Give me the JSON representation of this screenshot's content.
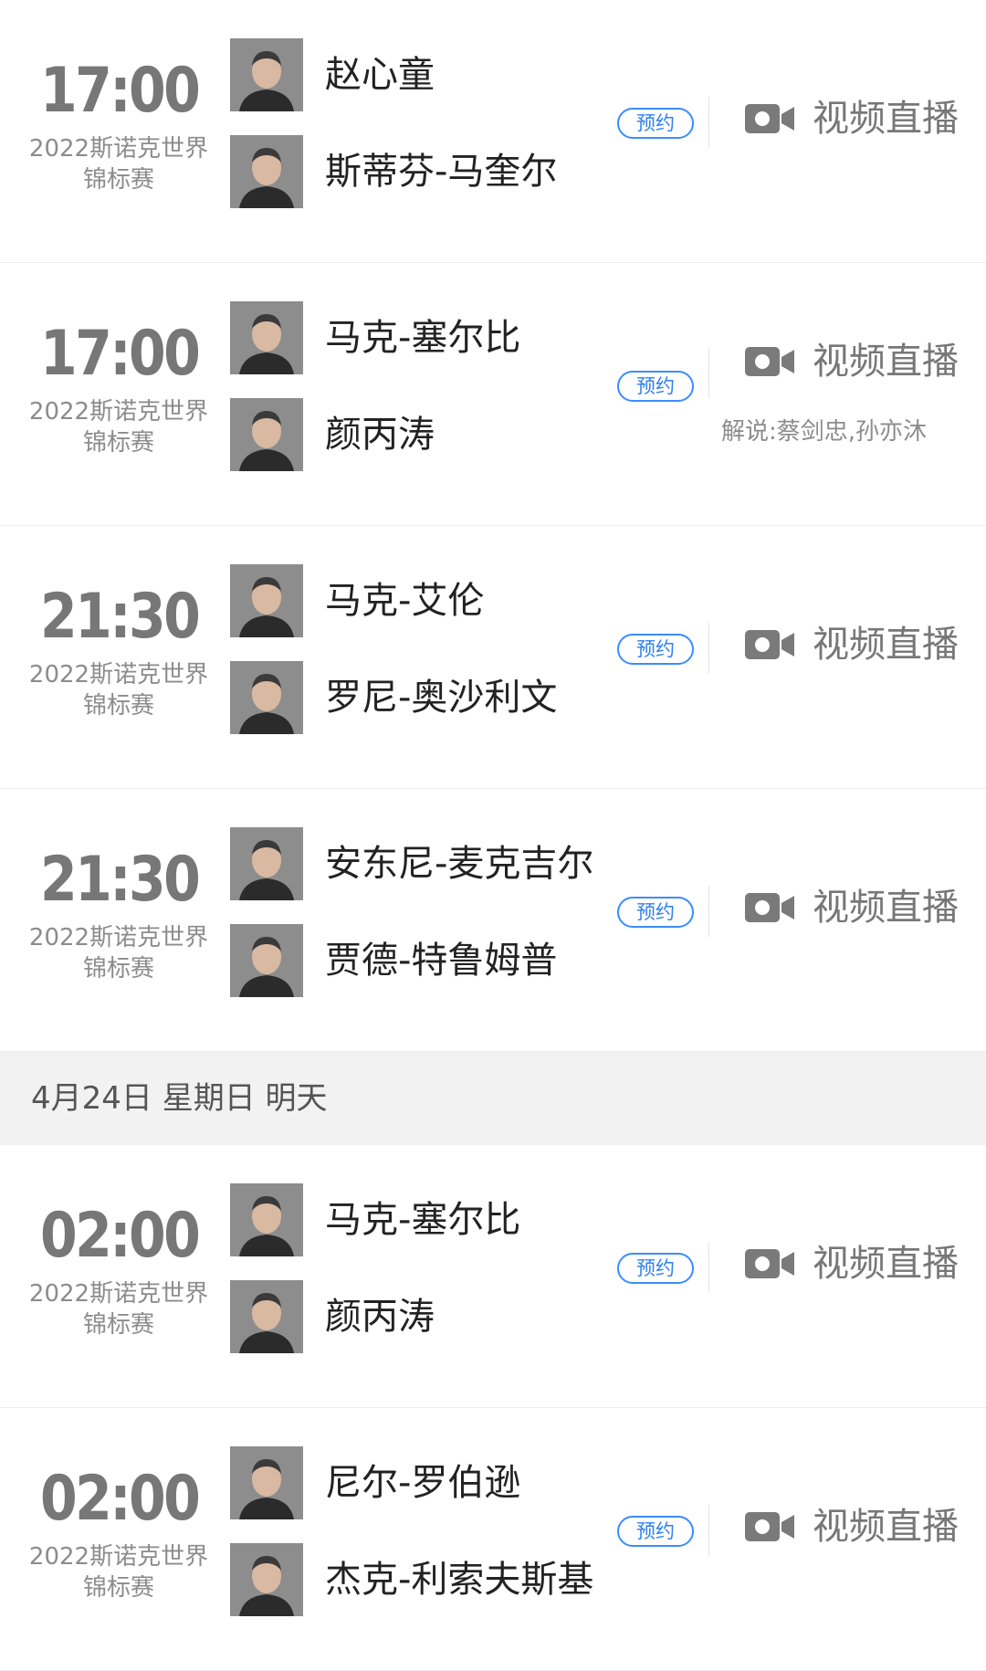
{
  "groups": [
    {
      "date_header": "",
      "matches": [
        {
          "time": "17:00",
          "event": "2022斯诺克世界锦标赛",
          "players": [
            "赵心童",
            "斯蒂芬-马奎尔"
          ],
          "reserve_label": "预约",
          "live_label": "视频直播",
          "commentary": ""
        },
        {
          "time": "17:00",
          "event": "2022斯诺克世界锦标赛",
          "players": [
            "马克-塞尔比",
            "颜丙涛"
          ],
          "reserve_label": "预约",
          "live_label": "视频直播",
          "commentary": "解说:蔡剑忠,孙亦沐"
        },
        {
          "time": "21:30",
          "event": "2022斯诺克世界锦标赛",
          "players": [
            "马克-艾伦",
            "罗尼-奥沙利文"
          ],
          "reserve_label": "预约",
          "live_label": "视频直播",
          "commentary": ""
        },
        {
          "time": "21:30",
          "event": "2022斯诺克世界锦标赛",
          "players": [
            "安东尼-麦克吉尔",
            "贾德-特鲁姆普"
          ],
          "reserve_label": "预约",
          "live_label": "视频直播",
          "commentary": ""
        }
      ]
    },
    {
      "date_header": "4月24日 星期日 明天",
      "matches": [
        {
          "time": "02:00",
          "event": "2022斯诺克世界锦标赛",
          "players": [
            "马克-塞尔比",
            "颜丙涛"
          ],
          "reserve_label": "预约",
          "live_label": "视频直播",
          "commentary": ""
        },
        {
          "time": "02:00",
          "event": "2022斯诺克世界锦标赛",
          "players": [
            "尼尔-罗伯逊",
            "杰克-利索夫斯基"
          ],
          "reserve_label": "预约",
          "live_label": "视频直播",
          "commentary": ""
        }
      ]
    }
  ],
  "icons": {
    "avatar": "player-avatar-icon",
    "live": "video-camera-icon"
  },
  "colors": {
    "accent": "#2f80f0",
    "header_bg": "#f2f2f2",
    "muted": "#777777"
  }
}
